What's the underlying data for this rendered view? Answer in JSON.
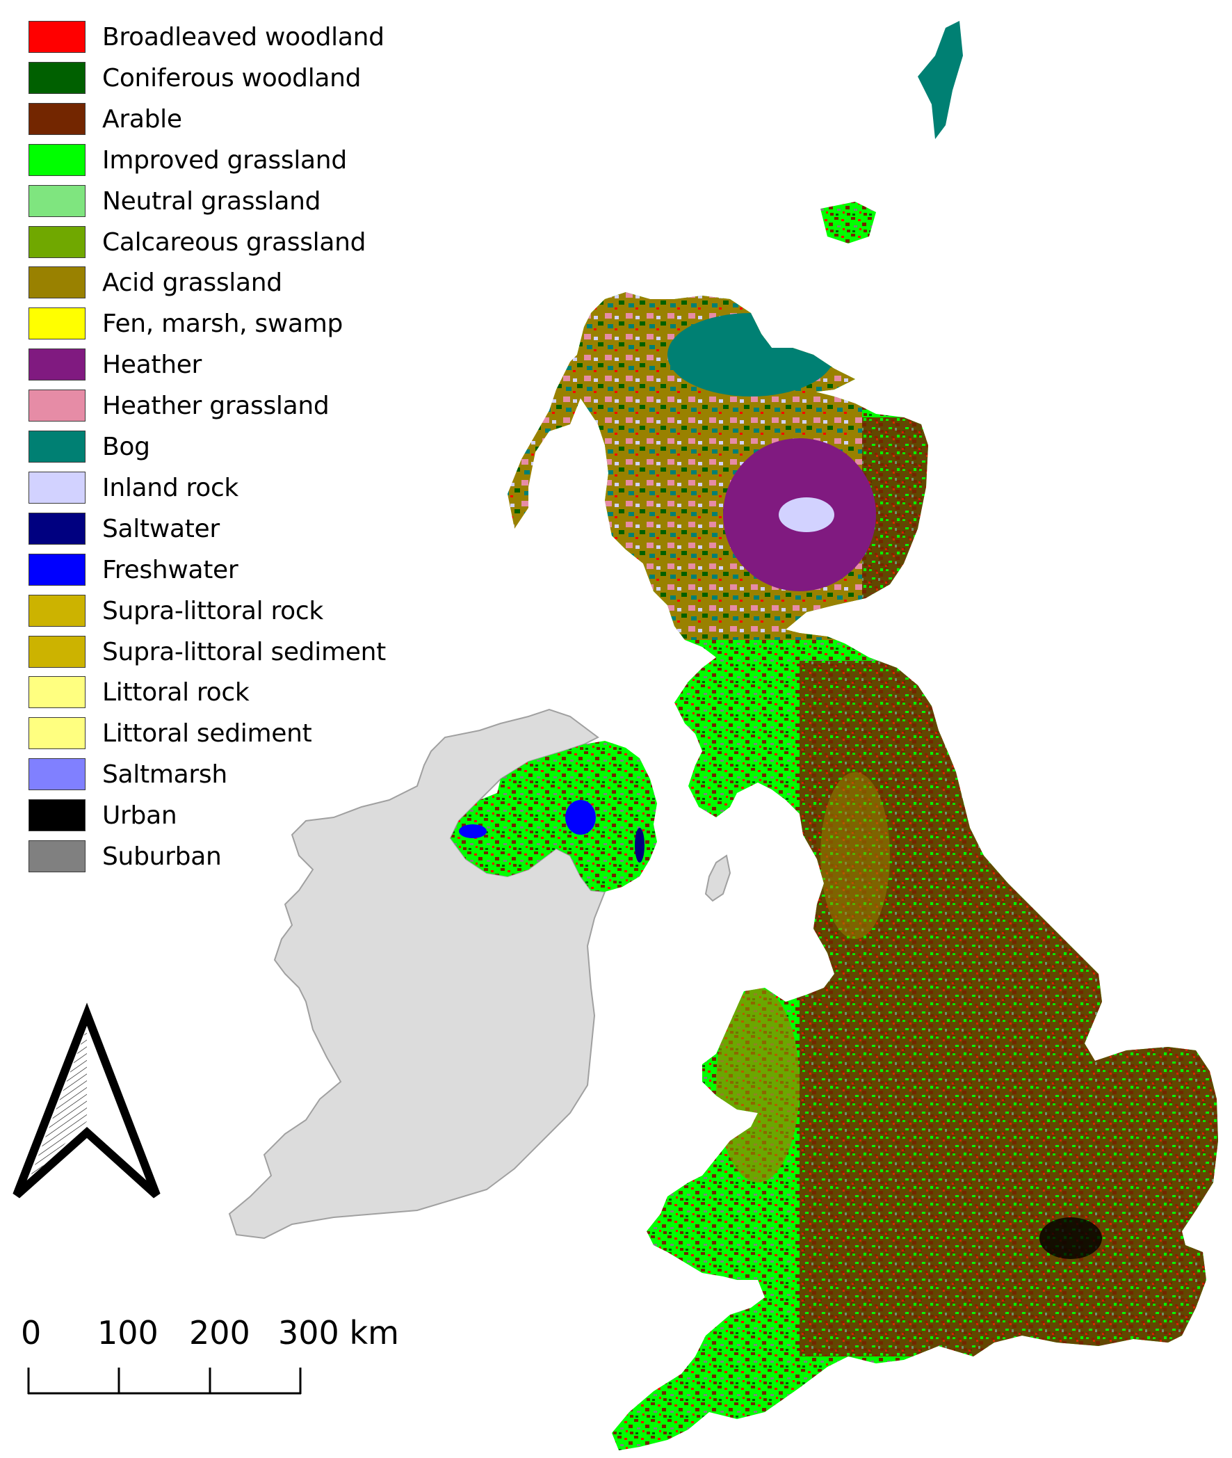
{
  "legend": {
    "items": [
      {
        "label": "Broadleaved woodland",
        "color": "#ff0000"
      },
      {
        "label": "Coniferous woodland",
        "color": "#006000"
      },
      {
        "label": "Arable",
        "color": "#732600"
      },
      {
        "label": "Improved grassland",
        "color": "#00ff00"
      },
      {
        "label": "Neutral grassland",
        "color": "#7fe57f"
      },
      {
        "label": "Calcareous grassland",
        "color": "#70a800"
      },
      {
        "label": "Acid grassland",
        "color": "#998100"
      },
      {
        "label": "Fen, marsh, swamp",
        "color": "#ffff00"
      },
      {
        "label": "Heather",
        "color": "#801a80"
      },
      {
        "label": "Heather grassland",
        "color": "#e68ca6"
      },
      {
        "label": "Bog",
        "color": "#008073"
      },
      {
        "label": "Inland rock",
        "color": "#d2d2ff"
      },
      {
        "label": "Saltwater",
        "color": "#000080"
      },
      {
        "label": "Freshwater",
        "color": "#0000ff"
      },
      {
        "label": "Supra-littoral rock",
        "color": "#ccb300"
      },
      {
        "label": "Supra-littoral sediment",
        "color": "#ccb300"
      },
      {
        "label": "Littoral rock",
        "color": "#ffff80"
      },
      {
        "label": "Littoral sediment",
        "color": "#ffff80"
      },
      {
        "label": "Saltmarsh",
        "color": "#8080ff"
      },
      {
        "label": "Urban",
        "color": "#000000"
      },
      {
        "label": "Suburban",
        "color": "#808080"
      }
    ]
  },
  "basemap": {
    "ireland_fill": "#dcdcdc",
    "ireland_outline": "#a0a0a0"
  },
  "north_arrow": {
    "direction": "north"
  },
  "scalebar": {
    "ticks": [
      "0",
      "100",
      "200"
    ],
    "last_tick": "300",
    "unit": "km",
    "max_km": 300
  }
}
